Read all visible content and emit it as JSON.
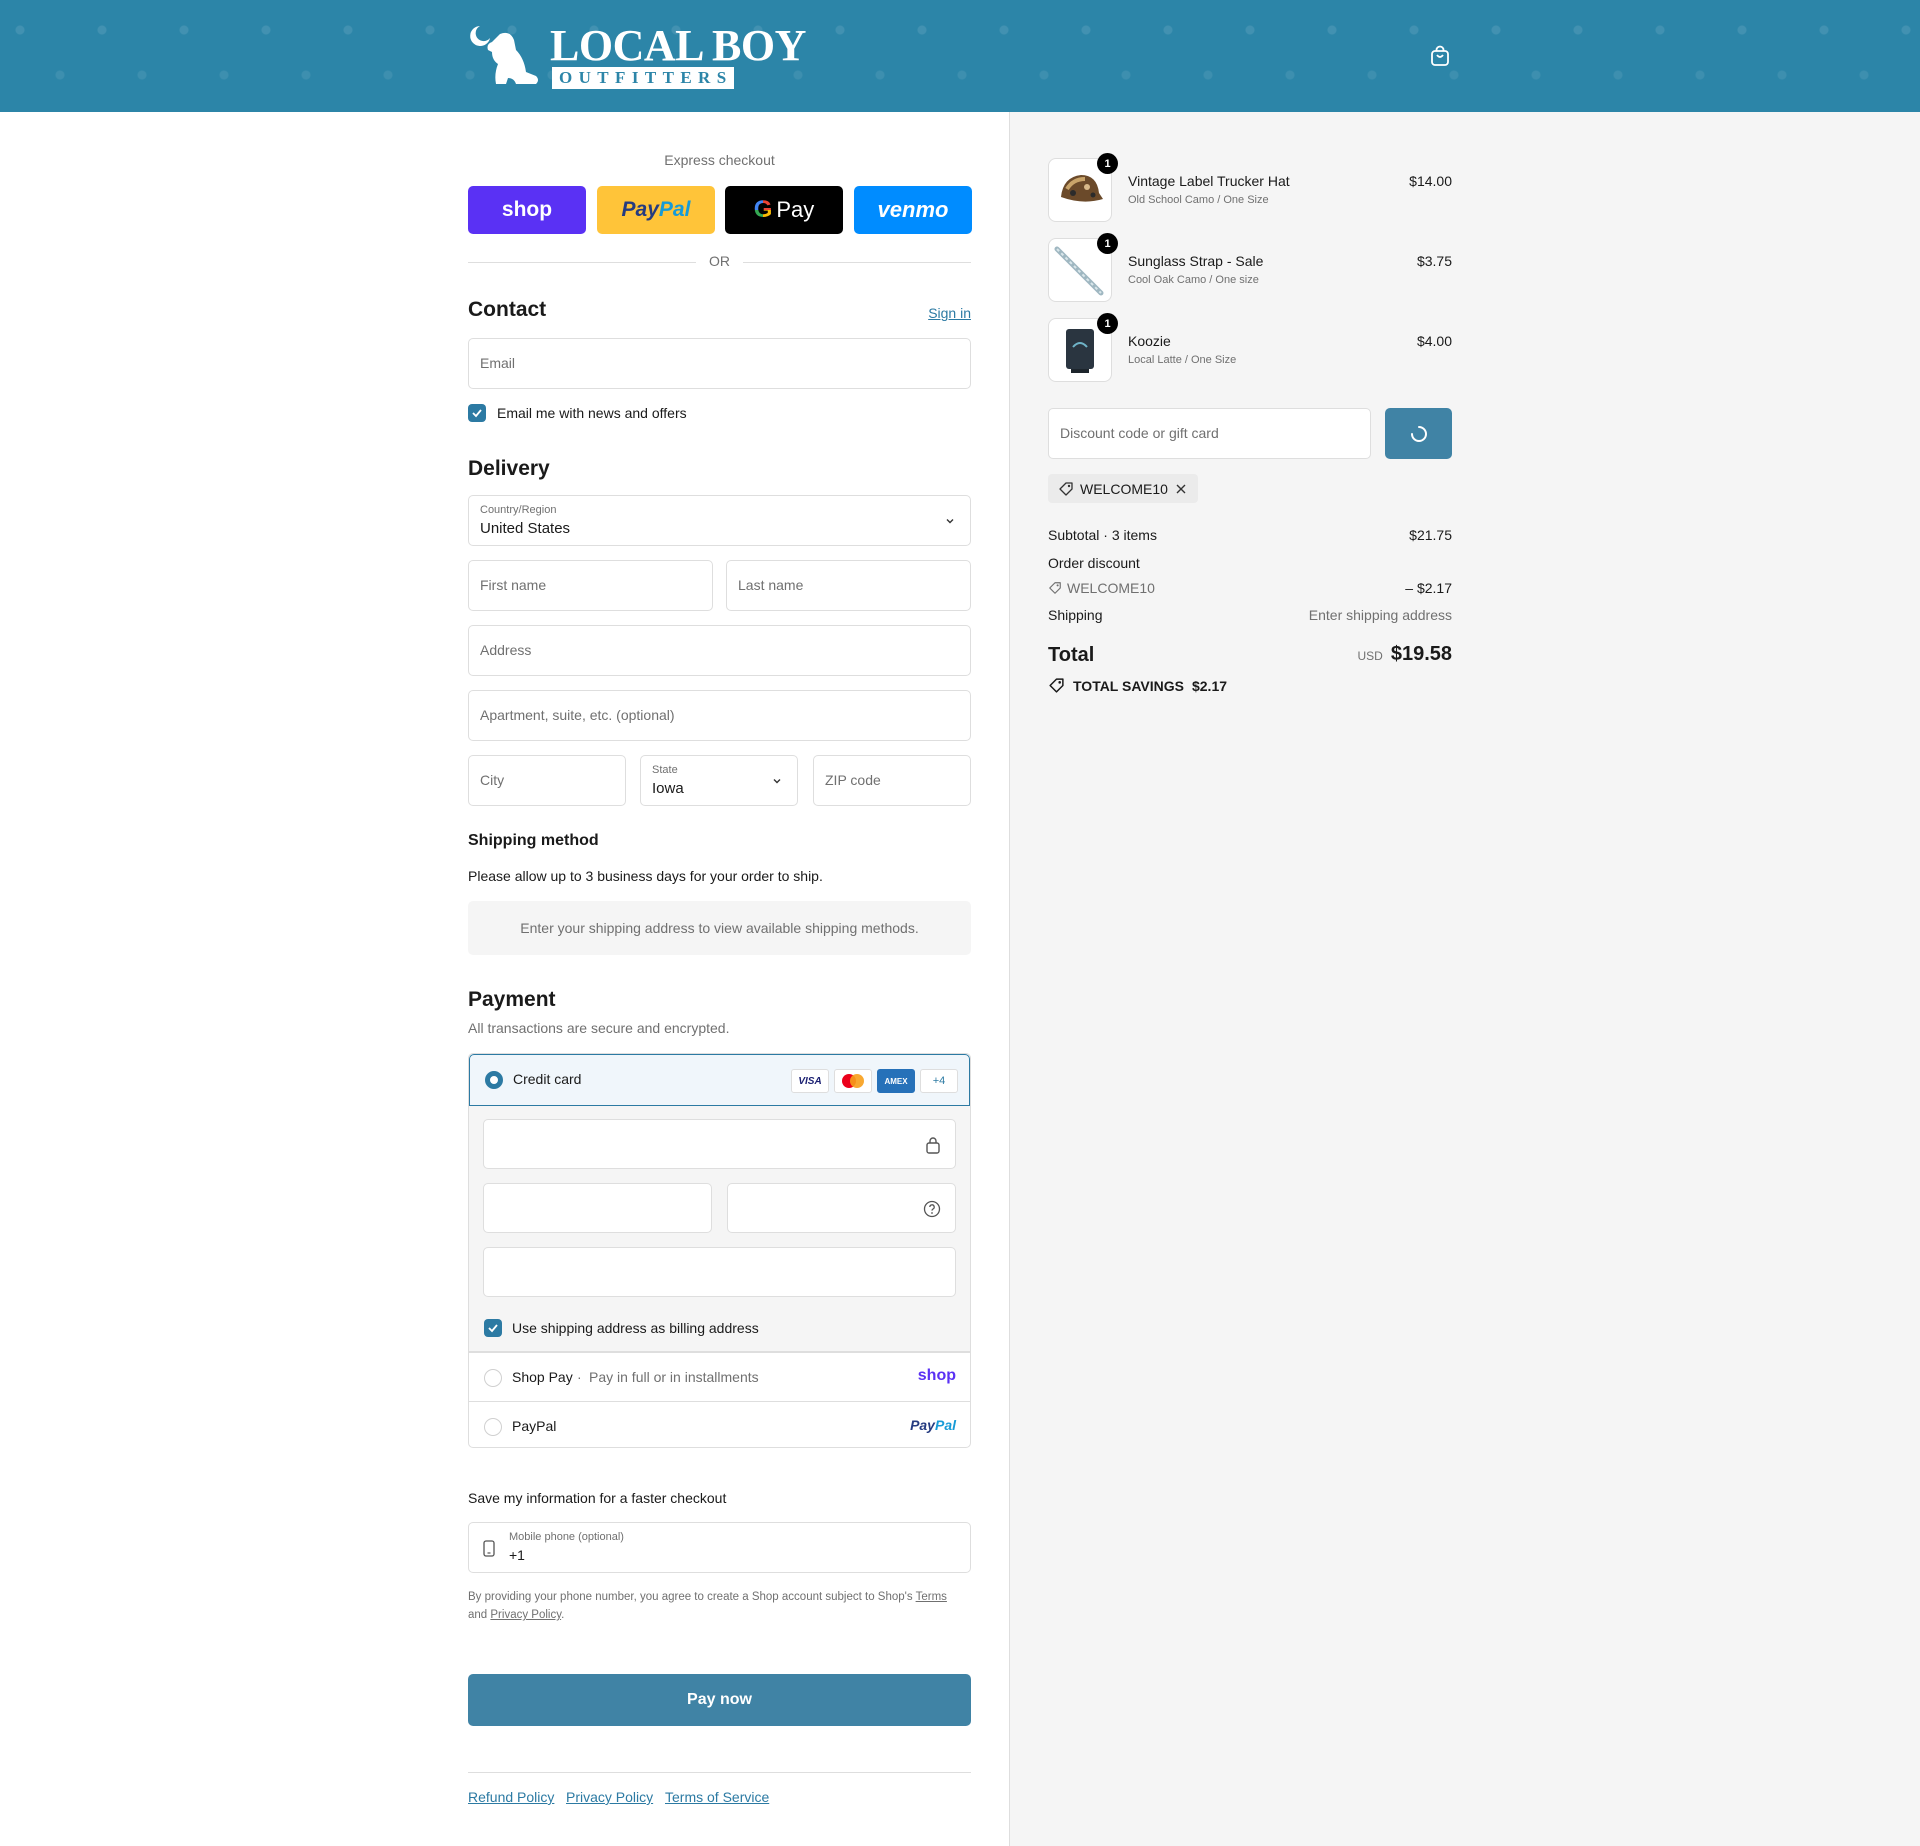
{
  "brand": {
    "name": "LOCAL BOY",
    "subtitle": "OUTFITTERS",
    "accent": "#2c85a8",
    "button": "#4083a5",
    "link": "#2c7aa3"
  },
  "express": {
    "title": "Express checkout",
    "shop_label": "shop",
    "paypal_a": "Pay",
    "paypal_b": "Pal",
    "gpay_label": "Pay",
    "venmo_label": "venmo",
    "or_label": "OR"
  },
  "contact": {
    "title": "Contact",
    "sign_in": "Sign in",
    "email_placeholder": "Email",
    "news_label": "Email me with news and offers"
  },
  "delivery": {
    "title": "Delivery",
    "country_label": "Country/Region",
    "country_value": "United States",
    "first_name_placeholder": "First name",
    "last_name_placeholder": "Last name",
    "address_placeholder": "Address",
    "apartment_placeholder": "Apartment, suite, etc. (optional)",
    "city_placeholder": "City",
    "state_label": "State",
    "state_value": "Iowa",
    "zip_placeholder": "ZIP code"
  },
  "shipping": {
    "title": "Shipping method",
    "note": "Please allow up to 3 business days for your order to ship.",
    "empty": "Enter your shipping address to view available shipping methods."
  },
  "payment": {
    "title": "Payment",
    "subtitle": "All transactions are secure and encrypted.",
    "credit_card": "Credit card",
    "card_brands": [
      "VISA",
      "AMEX",
      "+4"
    ],
    "billing_label": "Use shipping address as billing address",
    "shop_pay": "Shop Pay",
    "shop_pay_sep": "·",
    "shop_pay_note": "Pay in full or in installments",
    "shop_pay_logo": "shop",
    "paypal": "PayPal",
    "paypal_logo_a": "Pay",
    "paypal_logo_b": "Pal"
  },
  "save_info": {
    "title": "Save my information for a faster checkout",
    "phone_label": "Mobile phone (optional)",
    "phone_value": "+1",
    "legal_prefix": "By providing your phone number, you agree to create a Shop account subject to Shop's",
    "terms": "Terms",
    "and": "and",
    "privacy": "Privacy Policy",
    "period": "."
  },
  "pay_now": "Pay now",
  "footer": {
    "links": [
      "Refund Policy",
      "Privacy Policy",
      "Terms of Service"
    ]
  },
  "order": {
    "items": [
      {
        "name": "Vintage Label Trucker Hat",
        "variant": "Old School Camo / One Size",
        "price": "$14.00",
        "qty": "1"
      },
      {
        "name": "Sunglass Strap - Sale",
        "variant": "Cool Oak Camo / One size",
        "price": "$3.75",
        "qty": "1"
      },
      {
        "name": "Koozie",
        "variant": "Local Latte / One Size",
        "price": "$4.00",
        "qty": "1"
      }
    ],
    "discount_placeholder": "Discount code or gift card",
    "applied_code": "WELCOME10",
    "subtotal_label": "Subtotal · 3 items",
    "subtotal_value": "$21.75",
    "order_discount_label": "Order discount",
    "discount_code": "WELCOME10",
    "discount_value": "– $2.17",
    "shipping_label": "Shipping",
    "shipping_value": "Enter shipping address",
    "total_label": "Total",
    "currency": "USD",
    "total_value": "$19.58",
    "savings_label": "TOTAL SAVINGS",
    "savings_value": "$2.17"
  }
}
